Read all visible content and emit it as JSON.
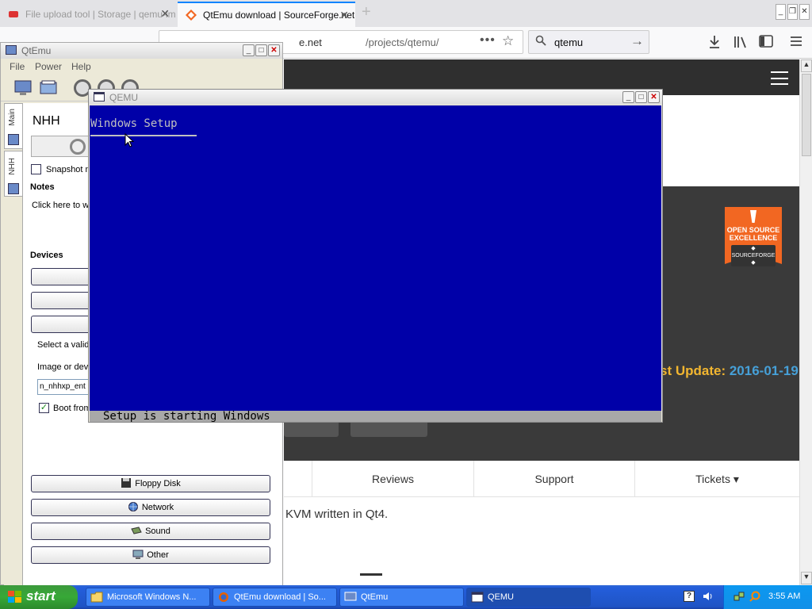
{
  "firefox": {
    "tabs": [
      {
        "title": "File upload tool | Storage | qemu-img",
        "active": false
      },
      {
        "title": "QtEmu download | SourceForge.net",
        "active": true
      }
    ],
    "window_controls": {
      "minimize": "_",
      "restore": "❐",
      "close": "✕"
    },
    "url": {
      "host": "e.net",
      "path": "/projects/qtemu/"
    },
    "search": {
      "value": "qtemu"
    },
    "icons": [
      "download-icon",
      "library-icon",
      "sidebar-icon",
      "menu-icon"
    ]
  },
  "sourceforge": {
    "badge": {
      "line1": "OPEN SOURCE",
      "line2": "EXCELLENCE",
      "line3": "◆ SOURCEFORGE ◆"
    },
    "last_update": {
      "label": "st Update: ",
      "value": "2016-01-19"
    },
    "tabs": [
      "Reviews",
      "Support",
      "Tickets ▾"
    ],
    "description": "KVM written in Qt4."
  },
  "qtemu": {
    "title": "QtEmu",
    "menu": [
      "File",
      "Power",
      "Help"
    ],
    "side_tabs": [
      "Main",
      "NHH"
    ],
    "vm_name": "NHH",
    "snapshot_label": "Snapshot m",
    "notes_heading": "Notes",
    "notes_text": "Click here to w",
    "devices_heading": "Devices",
    "select_label": "Select a valid",
    "image_label": "Image or devi",
    "image_value": "n_nhhxp_ent",
    "boot_label": "Boot from",
    "boot_checked": "✓",
    "device_buttons": [
      "Floppy Disk",
      "Network",
      "Sound",
      "Other"
    ]
  },
  "qemu": {
    "title": "QEMU",
    "screen_title": "Windows Setup",
    "status_text": "Setup is starting Windows",
    "screen_bg": "#0000a8",
    "status_bg": "#a8a8a8"
  },
  "taskbar": {
    "start_label": "start",
    "tasks": [
      {
        "label": "Microsoft Windows N...",
        "icon": "folder-icon",
        "active": false
      },
      {
        "label": "QtEmu download | So...",
        "icon": "firefox-icon",
        "active": false
      },
      {
        "label": "QtEmu",
        "icon": "qtemu-icon",
        "active": false
      },
      {
        "label": "QEMU",
        "icon": "qemu-icon",
        "active": true
      }
    ],
    "clock": "3:55 AM",
    "quick_launch_help": "?"
  },
  "colors": {
    "xp_blue": "#245edb",
    "xp_green": "#37a837",
    "firefox_accent": "#0a84ff",
    "sf_orange": "#f26722",
    "sf_yellow": "#f2b630",
    "sf_blue": "#46a0d8"
  }
}
